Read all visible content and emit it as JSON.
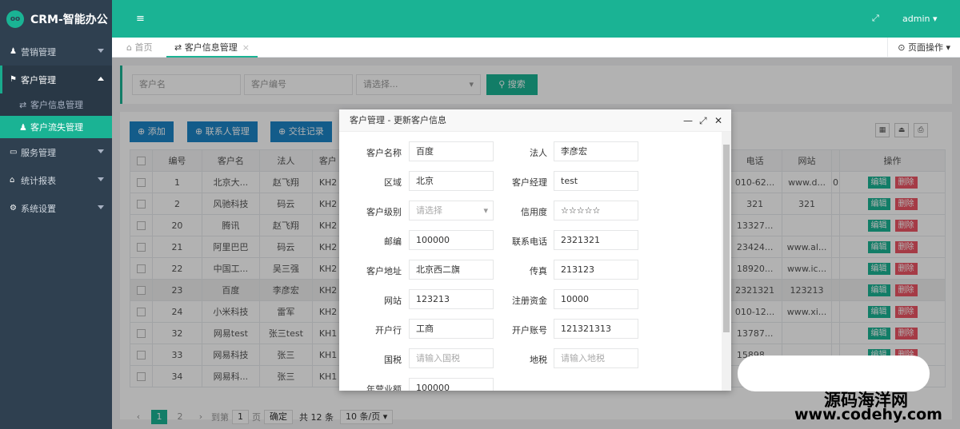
{
  "app": {
    "title": "CRM-智能办公",
    "logo_text": "oo"
  },
  "sidebar": {
    "items": [
      {
        "label": "营销管理",
        "icon": "user-icon"
      },
      {
        "label": "客户管理",
        "icon": "flag-icon"
      },
      {
        "label": "服务管理",
        "icon": "monitor-icon"
      },
      {
        "label": "统计报表",
        "icon": "home-icon"
      },
      {
        "label": "系统设置",
        "icon": "gears-icon"
      }
    ],
    "sub_items": [
      {
        "label": "客户信息管理"
      },
      {
        "label": "客户流失管理"
      }
    ]
  },
  "topbar": {
    "toggle": "≡",
    "fullscreen": "⤢",
    "user": "admin ▾"
  },
  "tabs": {
    "home": "首页",
    "current": "客户信息管理",
    "close": "×",
    "page_ops": "⊙ 页面操作 ▾"
  },
  "search": {
    "name_placeholder": "客户名",
    "code_placeholder": "客户编号",
    "select_placeholder": "请选择...",
    "button": "搜索"
  },
  "toolbar": {
    "add": "添加",
    "contacts": "联系人管理",
    "records": "交往记录"
  },
  "table": {
    "headers": [
      "",
      "编号",
      "客户名",
      "法人",
      "客户",
      "电话",
      "网站",
      "",
      "操作"
    ],
    "rows": [
      {
        "id": "1",
        "name": "北京大...",
        "legal": "赵飞翔",
        "code": "KH2",
        "phone": "010-62...",
        "site": "www.d...",
        "extra": "0"
      },
      {
        "id": "2",
        "name": "风驰科技",
        "legal": "码云",
        "code": "KH2",
        "phone": "321",
        "site": "321",
        "extra": ""
      },
      {
        "id": "20",
        "name": "腾讯",
        "legal": "赵飞翔",
        "code": "KH2",
        "phone": "13327...",
        "site": "",
        "extra": ""
      },
      {
        "id": "21",
        "name": "阿里巴巴",
        "legal": "码云",
        "code": "KH2",
        "phone": "23424...",
        "site": "www.al...",
        "extra": ""
      },
      {
        "id": "22",
        "name": "中国工...",
        "legal": "吴三强",
        "code": "KH2",
        "phone": "18920...",
        "site": "www.ic...",
        "extra": ""
      },
      {
        "id": "23",
        "name": "百度",
        "legal": "李彦宏",
        "code": "KH2",
        "phone": "2321321",
        "site": "123213",
        "extra": ""
      },
      {
        "id": "24",
        "name": "小米科技",
        "legal": "雷军",
        "code": "KH2",
        "phone": "010-12...",
        "site": "www.xi...",
        "extra": ""
      },
      {
        "id": "32",
        "name": "网易test",
        "legal": "张三test",
        "code": "KH1",
        "phone": "13787...",
        "site": "",
        "extra": ""
      },
      {
        "id": "33",
        "name": "网易科技",
        "legal": "张三",
        "code": "KH1",
        "phone": "15898...",
        "site": "",
        "extra": ""
      },
      {
        "id": "34",
        "name": "网易科...",
        "legal": "张三",
        "code": "KH1",
        "phone": "",
        "site": "",
        "extra": ""
      }
    ],
    "edit": "编辑",
    "delete": "删除"
  },
  "pager": {
    "prev": "‹",
    "page1": "1",
    "page2": "2",
    "next": "›",
    "goto": "到第",
    "goto_value": "1",
    "page_unit": "页",
    "confirm": "确定",
    "total": "共 12 条",
    "per_page": "10 条/页 ▾"
  },
  "modal": {
    "title": "客户管理 - 更新客户信息",
    "controls": {
      "min": "—",
      "max": "⤢",
      "close": "✕"
    },
    "fields": [
      {
        "label": "客户名称",
        "value": "百度"
      },
      {
        "label": "法人",
        "value": "李彦宏"
      },
      {
        "label": "区域",
        "value": "北京"
      },
      {
        "label": "客户经理",
        "value": "test"
      },
      {
        "label": "客户级别",
        "value": "请选择"
      },
      {
        "label": "信用度",
        "value": "☆☆☆☆☆"
      },
      {
        "label": "邮编",
        "value": "100000"
      },
      {
        "label": "联系电话",
        "value": "2321321"
      },
      {
        "label": "客户地址",
        "value": "北京西二旗"
      },
      {
        "label": "传真",
        "value": "213123"
      },
      {
        "label": "网站",
        "value": "123213"
      },
      {
        "label": "注册资金",
        "value": "10000"
      },
      {
        "label": "开户行",
        "value": "工商"
      },
      {
        "label": "开户账号",
        "value": "121321313"
      },
      {
        "label": "国税",
        "value": "请输入国税"
      },
      {
        "label": "地税",
        "value": "请输入地税"
      },
      {
        "label": "年营业额",
        "value": "100000"
      }
    ]
  },
  "watermark": {
    "line1": "源码海洋网",
    "line2": "www.codehy.com"
  }
}
